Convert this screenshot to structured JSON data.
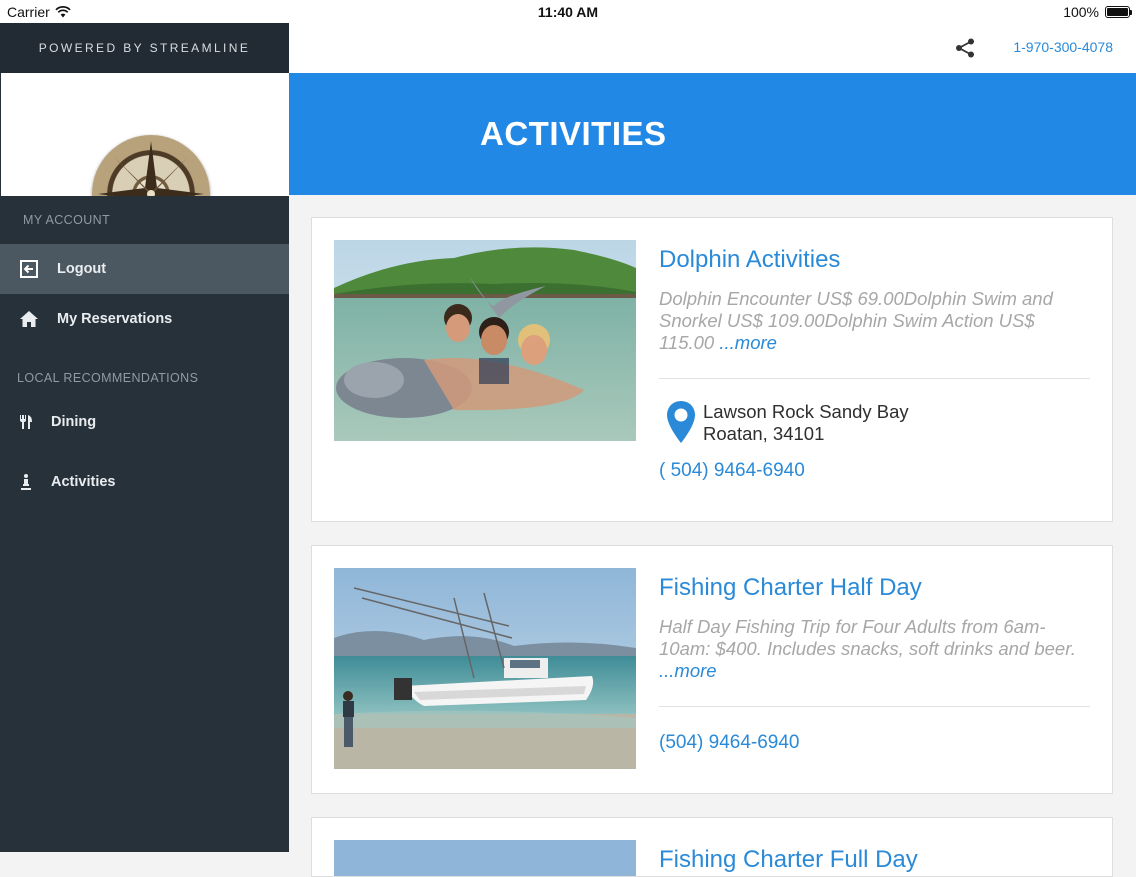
{
  "status_bar": {
    "carrier": "Carrier",
    "time": "11:40 AM",
    "battery": "100%"
  },
  "sidebar": {
    "powered_by": "POWERED BY STREAMLINE",
    "my_account_label": "MY ACCOUNT",
    "items": [
      {
        "label": "Logout",
        "icon": "logout-icon",
        "active": true
      },
      {
        "label": "My Reservations",
        "icon": "home-icon",
        "active": false
      }
    ],
    "local_label": "LOCAL RECOMMENDATIONS",
    "local_items": [
      {
        "label": "Dining",
        "icon": "fork-knife-icon"
      },
      {
        "label": "Activities",
        "icon": "activities-icon"
      }
    ]
  },
  "header": {
    "phone": "1-970-300-4078",
    "share_icon": "share-icon"
  },
  "banner": {
    "title": "ACTIVITIES",
    "color": "#2288e6"
  },
  "cards": [
    {
      "title": "Dolphin Activities",
      "description": "Dolphin Encounter US$ 69.00Dolphin Swim and Snorkel US$ 109.00Dolphin Swim Action US$ 115.00 ",
      "more": "...more",
      "address_line1": "Lawson Rock Sandy Bay",
      "address_line2": "Roatan, 34101",
      "phone": "( 504) 9464-6940"
    },
    {
      "title": "Fishing Charter Half Day",
      "description": "Half Day Fishing Trip for Four Adults from 6am-10am: $400. Includes snacks, soft drinks and beer. ",
      "more": "...more",
      "phone": "(504) 9464-6940"
    },
    {
      "title": "Fishing Charter Full Day"
    }
  ],
  "accent_color": "#2a8ad8"
}
